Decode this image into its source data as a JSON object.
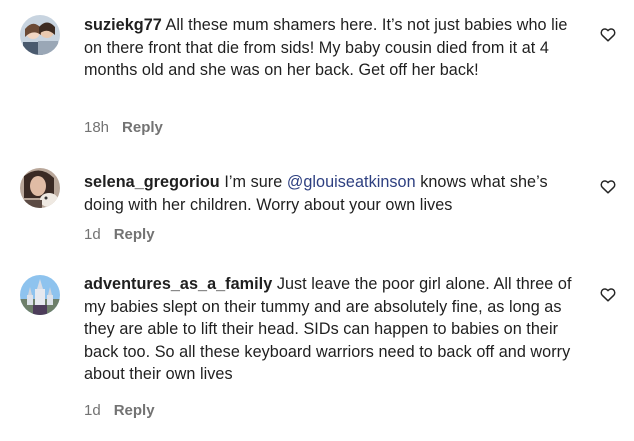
{
  "comments": [
    {
      "username": "suziekg77",
      "text": "All these mum shamers here. It’s not just babies who lie on there front that die from sids! My baby cousin died from it at 4 months old and she was on her back. Get off her back!",
      "time": "18h",
      "reply_label": "Reply",
      "avatar_icon": "profile-photo-avatar",
      "like_icon": "heart-outline-icon"
    },
    {
      "username": "selena_gregoriou",
      "text_before": "I’m sure",
      "mention": "@glouiseatkinson",
      "text_after": "knows what she’s doing with her children. Worry about your own lives",
      "time": "1d",
      "reply_label": "Reply",
      "avatar_icon": "profile-photo-avatar",
      "like_icon": "heart-outline-icon"
    },
    {
      "username": "adventures_as_a_family",
      "text": "Just leave the poor girl alone. All three of my babies slept on their tummy and are absolutely fine, as long as they are able to lift their head. SIDs can happen to babies on their back too. So all these keyboard warriors need to back off and worry about their own lives",
      "time": "1d",
      "reply_label": "Reply",
      "avatar_icon": "profile-photo-avatar",
      "like_icon": "heart-outline-icon"
    }
  ],
  "colors": {
    "text": "#1f1f1f",
    "meta": "#737373",
    "mention": "#2d3f80",
    "background": "#ffffff"
  }
}
